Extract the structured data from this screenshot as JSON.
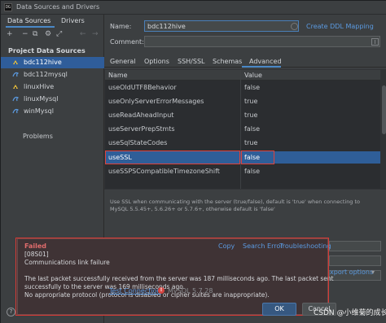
{
  "window": {
    "title": "Data Sources and Drivers",
    "app_icon": "DG"
  },
  "left_panel": {
    "tabs": [
      {
        "label": "Data Sources"
      },
      {
        "label": "Drivers"
      }
    ],
    "toolbar": {
      "add": "+",
      "remove": "−",
      "copy": "⧉",
      "settings": "⚙",
      "more": "⤢",
      "back": "←",
      "forward": "→"
    },
    "section_title": "Project Data Sources",
    "sources": [
      {
        "label": "bdc112hive",
        "icon": "hive-icon"
      },
      {
        "label": "bdc112mysql",
        "icon": "mysql-icon"
      },
      {
        "label": "linuxHive",
        "icon": "hive-icon"
      },
      {
        "label": "linuxMysql",
        "icon": "mysql-icon"
      },
      {
        "label": "winMysql",
        "icon": "mysql-icon"
      }
    ],
    "problems": "Problems"
  },
  "form": {
    "name_label": "Name:",
    "name_value": "bdc112hive",
    "comment_label": "Comment:",
    "comment_value": "",
    "create_ddl": "Create DDL Mapping"
  },
  "tabs": [
    {
      "label": "General"
    },
    {
      "label": "Options"
    },
    {
      "label": "SSH/SSL"
    },
    {
      "label": "Schemas"
    },
    {
      "label": "Advanced"
    }
  ],
  "table": {
    "headers": {
      "name": "Name",
      "value": "Value"
    },
    "rows": [
      {
        "name": "useOldUTF8Behavior",
        "value": "false"
      },
      {
        "name": "useOnlyServerErrorMessages",
        "value": "true"
      },
      {
        "name": "useReadAheadInput",
        "value": "true"
      },
      {
        "name": "useServerPrepStmts",
        "value": "false"
      },
      {
        "name": "useSqlStateCodes",
        "value": "true"
      },
      {
        "name": "useSSL",
        "value": "false"
      },
      {
        "name": "useSSPSCompatibleTimezoneShift",
        "value": "false"
      }
    ]
  },
  "description": "Use SSL when communicating with the server (true/false), default is 'true' when connecting to MySQL 5.5.45+, 5.6.26+ or 5.7.6+, otherwise default is 'false'",
  "error_popup": {
    "title": "Failed",
    "actions": {
      "copy": "Copy",
      "search": "Search Error",
      "troubleshoot": "Troubleshooting"
    },
    "lines": [
      "[08S01]",
      "Communications link failure",
      "",
      "The last packet successfully received from the server was 187 milliseconds ago. The last packet sent",
      "successfully to the server was 169 milliseconds ago.",
      "No appropriate protocol (protocol is disabled or cipher suites are inappropriate)."
    ]
  },
  "footer": {
    "test_connection": "Test Connection",
    "driver": "MySQL 5.7.28",
    "export_options": "xport options",
    "ok": "OK",
    "cancel": "Cancel",
    "help": "?",
    "watermark": "CSDN @小维菊的成长"
  },
  "colors": {
    "accent": "#4a88c7",
    "selection": "#2f5e98",
    "error": "#e06c6c",
    "highlight_border": "#e0413a"
  }
}
